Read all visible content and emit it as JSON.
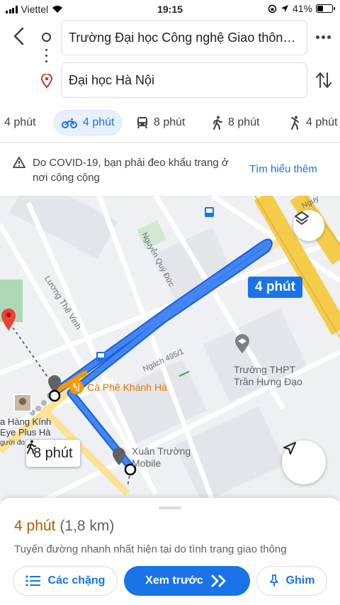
{
  "status_bar": {
    "carrier": "Viettel",
    "time": "19:15",
    "battery": "41%",
    "battery_level": 0.41
  },
  "route": {
    "origin": "Trường Đại học Công nghệ Giao thông...",
    "destination": "Đại học Hà Nội"
  },
  "modes": [
    {
      "icon": "car-icon",
      "label": "4 phút"
    },
    {
      "icon": "motorbike-icon",
      "label": "4 phút",
      "active": true
    },
    {
      "icon": "transit-icon",
      "label": "8 phút"
    },
    {
      "icon": "walk-icon",
      "label": "8 phút"
    },
    {
      "icon": "ride-icon",
      "label": "4 phút"
    }
  ],
  "banner": {
    "message": "Do COVID-19, bạn phải đeo khẩu trang ở nơi công cộng",
    "link": "Tìm hiểu thêm"
  },
  "map": {
    "streets": {
      "nguyen_quy_duc": "Nguyễn Quý Đức",
      "luong_the_vinh": "Lương Thế Vinh",
      "ngach": "Ngách 495/1",
      "nguy": "Nguy"
    },
    "pois": {
      "cafe": "Cà Phê Khánh Hà",
      "school_line1": "Trường THPT",
      "school_line2": "Trần Hưng Đạo",
      "mobile_line1": "Xuân Trường",
      "mobile_line2": "Mobile",
      "shop_line1": "a Hàng Kính",
      "shop_line2": "Eye Plus Hà",
      "shop_line3": "gười đo"
    },
    "route_time": "4 phút",
    "walk_time": "8 phút",
    "colors": {
      "route": "#4285f4",
      "route_border": "#1a5fd6",
      "highway": "#f5cc4a",
      "park": "#aed9b6"
    }
  },
  "sheet": {
    "eta": "4 phút",
    "distance": "(1,8 km)",
    "note": "Tuyến đường nhanh nhất hiện tại do tình trạng giao thông",
    "steps_button": "Các chặng",
    "preview_button": "Xem trước",
    "pin_button": "Ghim"
  }
}
